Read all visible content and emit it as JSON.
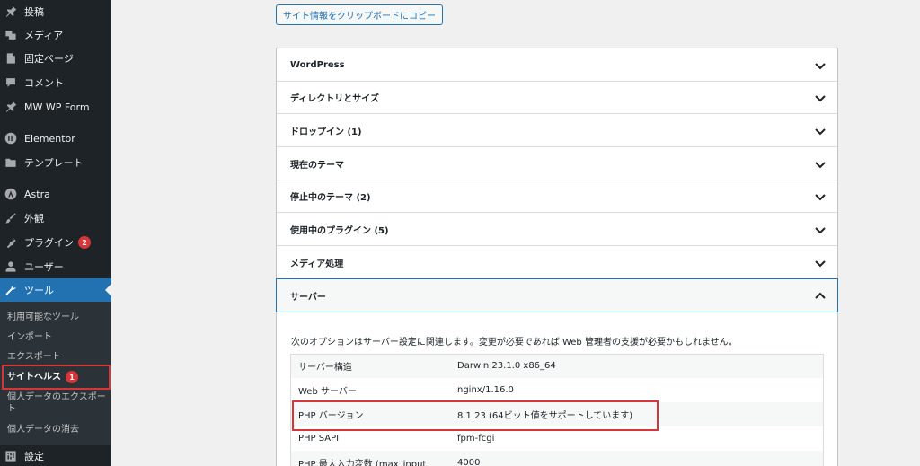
{
  "sidebar": {
    "items": [
      {
        "label": "投稿",
        "icon": "pin-icon"
      },
      {
        "label": "メディア",
        "icon": "media-icon"
      },
      {
        "label": "固定ページ",
        "icon": "page-icon"
      },
      {
        "label": "コメント",
        "icon": "comment-icon"
      },
      {
        "label": "MW WP Form",
        "icon": "pin-icon"
      },
      {
        "label": "Elementor",
        "icon": "elementor-icon"
      },
      {
        "label": "テンプレート",
        "icon": "folder-icon"
      },
      {
        "label": "Astra",
        "icon": "astra-icon"
      },
      {
        "label": "外観",
        "icon": "brush-icon"
      },
      {
        "label": "プラグイン",
        "icon": "plugin-icon",
        "badge": "2"
      },
      {
        "label": "ユーザー",
        "icon": "user-icon"
      },
      {
        "label": "ツール",
        "icon": "wrench-icon"
      },
      {
        "label": "設定",
        "icon": "settings-icon"
      }
    ],
    "submenu": [
      {
        "label": "利用可能なツール"
      },
      {
        "label": "インポート"
      },
      {
        "label": "エクスポート"
      },
      {
        "label": "サイトヘルス",
        "badge": "1"
      },
      {
        "label": "個人データのエクスポート"
      },
      {
        "label": "個人データの消去"
      }
    ]
  },
  "main": {
    "copy_button": "サイト情報をクリップボードにコピー",
    "sections": [
      "WordPress",
      "ディレクトリとサイズ",
      "ドロップイン (1)",
      "現在のテーマ",
      "停止中のテーマ (2)",
      "使用中のプラグイン (5)",
      "メディア処理",
      "サーバー"
    ],
    "server_description": "次のオプションはサーバー設定に関連します。変更が必要であれば Web 管理者の支援が必要かもしれません。",
    "server_rows": [
      {
        "key": "サーバー構造",
        "value": "Darwin 23.1.0 x86_64"
      },
      {
        "key": "Web サーバー",
        "value": "nginx/1.16.0"
      },
      {
        "key": "PHP バージョン",
        "value": "8.1.23 (64ビット値をサポートしています)"
      },
      {
        "key": "PHP SAPI",
        "value": "fpm-fcgi"
      },
      {
        "key": "PHP 最大入力変数 (max_input_",
        "value": "4000"
      }
    ]
  },
  "colors": {
    "sidebar_bg": "#1d2327",
    "accent": "#2271b1",
    "highlight": "#d63638"
  }
}
